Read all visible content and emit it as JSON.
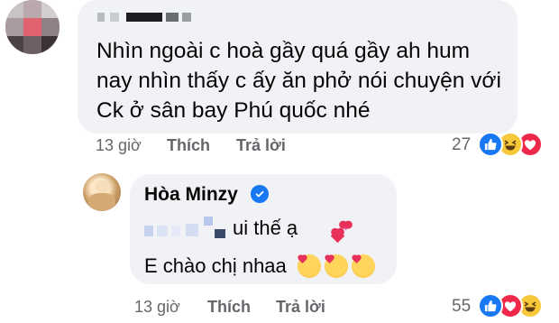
{
  "comment": {
    "text": "Nhìn ngoài c hoà gầy quá gầy ah hum nay nhìn thấy c ấy ăn phở nói chuyện với Ck ở sân bay Phú quốc nhé",
    "time": "13 giờ",
    "like_label": "Thích",
    "reply_label": "Trả lời",
    "reaction_count": "27",
    "reactions": [
      "like-icon",
      "haha-icon",
      "love-icon"
    ]
  },
  "reply": {
    "author": "Hòa Minzy",
    "line1": "ui thế ạ",
    "line2": "E chào chị nhaa",
    "time": "13 giờ",
    "like_label": "Thích",
    "reply_label": "Trả lời",
    "reaction_count": "55",
    "reactions": [
      "like-icon",
      "love-icon",
      "haha-icon"
    ]
  },
  "colors": {
    "bubble": "#f0f2f5",
    "meta_text": "#65676b",
    "like_blue": "#1877f2",
    "love_red": "#f0284a",
    "haha_yellow": "#f7c83a"
  }
}
